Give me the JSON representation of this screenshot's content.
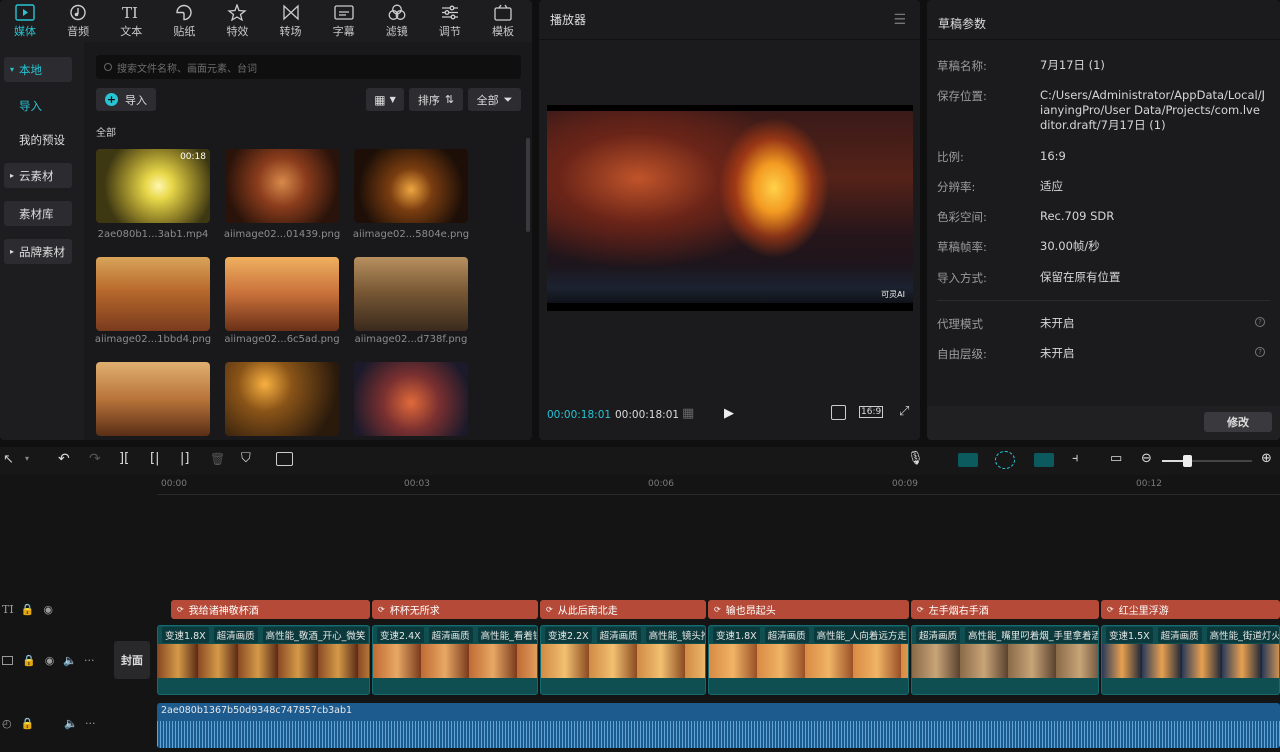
{
  "tabs": [
    {
      "label": "媒体",
      "icon": "media-icon"
    },
    {
      "label": "音频",
      "icon": "audio-icon"
    },
    {
      "label": "文本",
      "icon": "text-icon"
    },
    {
      "label": "贴纸",
      "icon": "sticker-icon"
    },
    {
      "label": "特效",
      "icon": "effects-icon"
    },
    {
      "label": "转场",
      "icon": "transition-icon"
    },
    {
      "label": "字幕",
      "icon": "subtitle-icon"
    },
    {
      "label": "滤镜",
      "icon": "filter-icon"
    },
    {
      "label": "调节",
      "icon": "adjust-icon"
    },
    {
      "label": "模板",
      "icon": "template-icon"
    }
  ],
  "left_nav": {
    "local": "本地",
    "import": "导入",
    "presets": "我的预设",
    "cloud": "云素材",
    "library": "素材库",
    "brand": "品牌素材"
  },
  "media": {
    "search_placeholder": "搜索文件名称、画面元素、台词",
    "import_label": "导入",
    "sort_label": "排序",
    "all_filter_label": "全部",
    "section_label": "全部",
    "items": [
      {
        "name": "2ae080b1...3ab1.mp4",
        "duration": "00:18"
      },
      {
        "name": "aiimage02...01439.png"
      },
      {
        "name": "aiimage02...5804e.png"
      },
      {
        "name": "aiimage02...1bbd4.png"
      },
      {
        "name": "aiimage02...6c5ad.png"
      },
      {
        "name": "aiimage02...d738f.png"
      },
      {
        "name": ""
      },
      {
        "name": ""
      },
      {
        "name": ""
      }
    ]
  },
  "player": {
    "title": "播放器",
    "current_time": "00:00:18:01",
    "total_time": "00:00:18:01",
    "ratio": "16:9",
    "watermark": "可灵AI"
  },
  "props": {
    "title": "草稿参数",
    "rows": [
      {
        "k": "草稿名称:",
        "v": "7月17日 (1)"
      },
      {
        "k": "保存位置:",
        "v": "C:/Users/Administrator/AppData/Local/JianyingPro/User Data/Projects/com.lveditor.draft/7月17日 (1)"
      },
      {
        "k": "比例:",
        "v": "16:9"
      },
      {
        "k": "分辨率:",
        "v": "适应"
      },
      {
        "k": "色彩空间:",
        "v": "Rec.709 SDR"
      },
      {
        "k": "草稿帧率:",
        "v": "30.00帧/秒"
      },
      {
        "k": "导入方式:",
        "v": "保留在原有位置"
      }
    ],
    "proxy_k": "代理模式",
    "proxy_v": "未开启",
    "layer_k": "自由层级:",
    "layer_v": "未开启",
    "modify_label": "修改"
  },
  "timeline": {
    "ticks": [
      "00:00",
      "00:03",
      "00:06",
      "00:09",
      "00:12"
    ],
    "cover_label": "封面",
    "text_clips": [
      "我给诸神敬杯酒",
      "杯杯无所求",
      "从此后南北走",
      "输也昂起头",
      "左手烟右手酒",
      "红尘里浮游"
    ],
    "video_clips": [
      {
        "tags": [
          "变速1.8X",
          "超清画质",
          "高性能_敬酒_开心_微笑"
        ]
      },
      {
        "tags": [
          "变速2.4X",
          "超清画质",
          "高性能_看着镜"
        ]
      },
      {
        "tags": [
          "变速2.2X",
          "超清画质",
          "高性能_镜头推"
        ]
      },
      {
        "tags": [
          "变速1.8X",
          "超清画质",
          "高性能_人向着远方走"
        ]
      },
      {
        "tags": [
          "超清画质",
          "高性能_嘴里叼着烟_手里拿着酒_"
        ]
      },
      {
        "tags": [
          "变速1.5X",
          "超清画质",
          "高性能_街道灯火"
        ]
      }
    ],
    "audio_label": "2ae080b1367b50d9348c747857cb3ab1"
  }
}
